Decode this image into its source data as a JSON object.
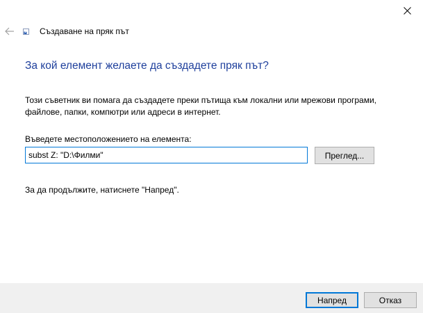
{
  "window": {
    "close_icon": "close-icon",
    "back_icon": "back-arrow-icon"
  },
  "wizard": {
    "icon": "shortcut-icon",
    "title": "Създаване на пряк път"
  },
  "content": {
    "heading": "За кой елемент желаете да създадете пряк път?",
    "description_line1": "Този съветник ви помага да създадете преки пътища към локални или мрежови програми,",
    "description_line2": "файлове, папки, компютри или адреси в интернет.",
    "location_label": "Въведете местоположението на елемента:",
    "location_value": "subst Z: \"D:\\Филми\"",
    "browse_label": "Преглед...",
    "continue_text": "За да продължите, натиснете \"Напред\"."
  },
  "footer": {
    "next_label": "Напред",
    "cancel_label": "Отказ"
  },
  "colors": {
    "heading": "#1e3f9c",
    "accent": "#0078d7",
    "footer_bg": "#f0f0f0",
    "button_bg": "#e1e1e1"
  }
}
